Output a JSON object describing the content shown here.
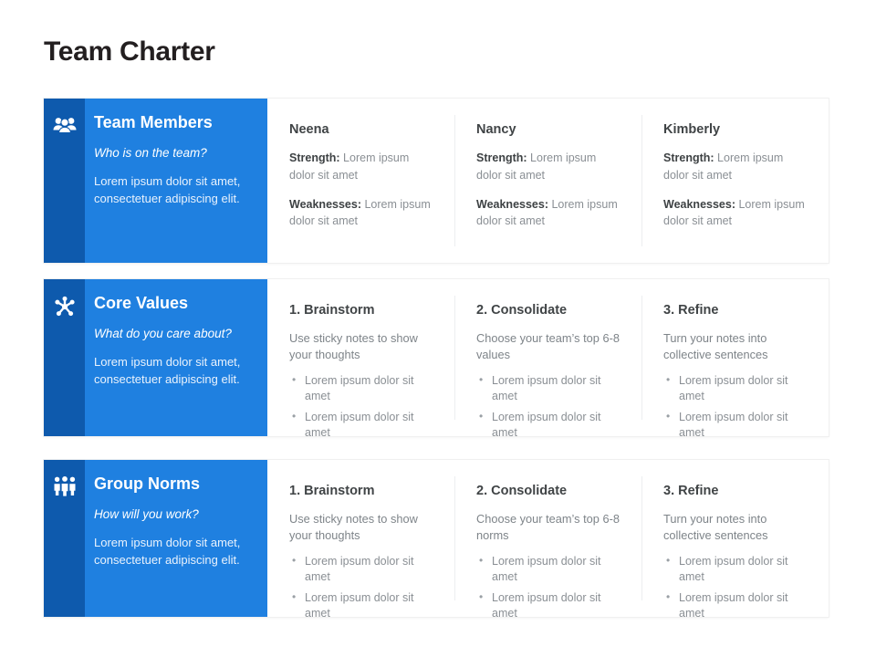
{
  "page": {
    "title": "Team Charter",
    "accent_blue": "#1f80e0",
    "accent_blue_dark": "#0e5aad",
    "heading_color": "#231f20",
    "body_gray": "#8a8f94"
  },
  "rows": [
    {
      "panel": {
        "icon": "team-people-icon",
        "title": "Team Members",
        "question": "Who is on the team?",
        "description": "Lorem ipsum dolor sit amet, consectetuer adipiscing elit."
      },
      "type": "members",
      "columns": [
        {
          "head": "Neena",
          "pairs": [
            {
              "label": "Strength:",
              "value": "Lorem ipsum dolor sit amet"
            },
            {
              "label": "Weaknesses:",
              "value": "Lorem ipsum dolor sit amet"
            }
          ]
        },
        {
          "head": "Nancy",
          "pairs": [
            {
              "label": "Strength:",
              "value": "Lorem ipsum dolor sit amet"
            },
            {
              "label": "Weaknesses:",
              "value": "Lorem ipsum dolor sit amet"
            }
          ]
        },
        {
          "head": "Kimberly",
          "pairs": [
            {
              "label": "Strength:",
              "value": "Lorem ipsum dolor sit amet"
            },
            {
              "label": "Weaknesses:",
              "value": "Lorem ipsum dolor sit amet"
            }
          ]
        }
      ]
    },
    {
      "panel": {
        "icon": "hub-node-icon",
        "title": "Core Values",
        "question": "What do you care about?",
        "description": "Lorem ipsum dolor sit amet, consectetuer adipiscing elit."
      },
      "type": "steps",
      "columns": [
        {
          "head": "1. Brainstorm",
          "sub": "Use sticky notes to show your thoughts",
          "bullets": [
            "Lorem ipsum dolor sit amet",
            "Lorem ipsum dolor sit amet"
          ]
        },
        {
          "head": "2. Consolidate",
          "sub": "Choose your team’s top 6-8 values",
          "bullets": [
            "Lorem ipsum dolor sit amet",
            "Lorem ipsum dolor sit amet"
          ]
        },
        {
          "head": "3. Refine",
          "sub": "Turn your notes into collective sentences",
          "bullets": [
            "Lorem ipsum dolor sit amet",
            "Lorem ipsum dolor sit amet"
          ]
        }
      ]
    },
    {
      "panel": {
        "icon": "three-persons-icon",
        "title": "Group Norms",
        "question": "How will you work?",
        "description": "Lorem ipsum dolor sit amet, consectetuer adipiscing elit."
      },
      "type": "steps",
      "columns": [
        {
          "head": "1. Brainstorm",
          "sub": "Use sticky notes to show your thoughts",
          "bullets": [
            "Lorem ipsum dolor sit amet",
            "Lorem ipsum dolor sit amet"
          ]
        },
        {
          "head": "2. Consolidate",
          "sub": "Choose your team’s top 6-8 norms",
          "bullets": [
            "Lorem ipsum dolor sit amet",
            "Lorem ipsum dolor sit amet"
          ]
        },
        {
          "head": "3. Refine",
          "sub": "Turn your notes into collective sentences",
          "bullets": [
            "Lorem ipsum dolor sit amet",
            "Lorem ipsum dolor sit amet"
          ]
        }
      ]
    }
  ]
}
